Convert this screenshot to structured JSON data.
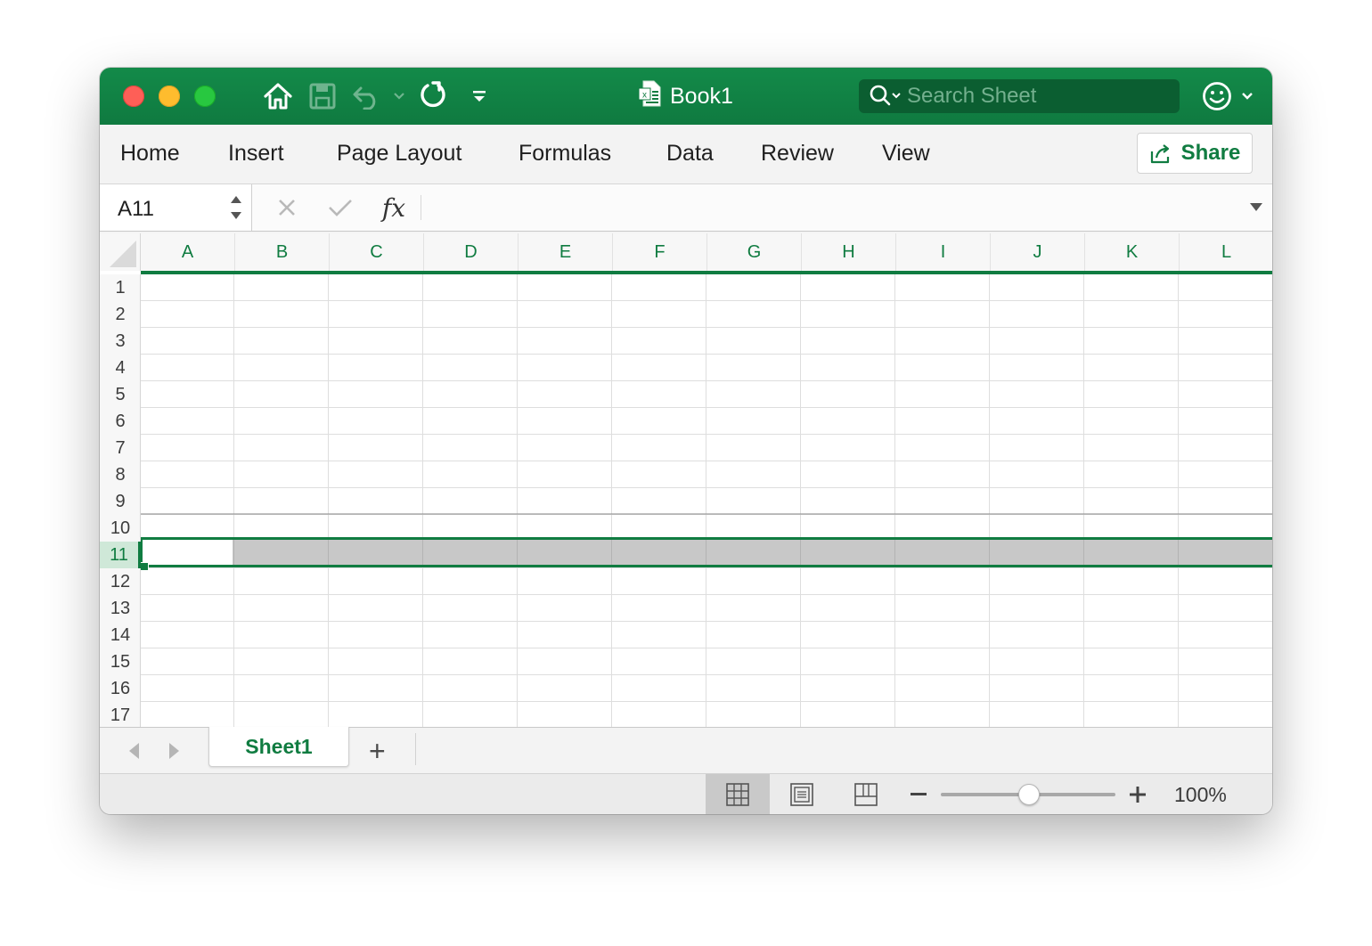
{
  "titlebar": {
    "doc_title": "Book1",
    "search_placeholder": "Search Sheet",
    "icons": [
      "home-icon",
      "save-icon",
      "undo-icon",
      "redo-icon",
      "customize-toolbar-icon",
      "excel-doc-icon",
      "search-icon",
      "smiley-feedback-icon"
    ]
  },
  "ribbon": {
    "tabs": [
      "Home",
      "Insert",
      "Page Layout",
      "Formulas",
      "Data",
      "Review",
      "View"
    ],
    "share_label": "Share"
  },
  "formula_bar": {
    "name_box": "A11",
    "fx_label": "fx",
    "formula_value": ""
  },
  "grid": {
    "columns": [
      "A",
      "B",
      "C",
      "D",
      "E",
      "F",
      "G",
      "H",
      "I",
      "J",
      "K",
      "L"
    ],
    "rows": [
      "1",
      "2",
      "3",
      "4",
      "5",
      "6",
      "7",
      "8",
      "9",
      "10",
      "11",
      "12",
      "13",
      "14",
      "15",
      "16",
      "17"
    ],
    "selected_row": "11",
    "active_cell": "A11"
  },
  "sheets": {
    "tabs": [
      "Sheet1"
    ],
    "active": "Sheet1",
    "add_label": "+"
  },
  "status": {
    "zoom": "100%",
    "zoom_fraction": 0.5
  },
  "colors": {
    "accent": "#107c41",
    "titlebar": "#107c41",
    "selection_fill": "#c8c8c8"
  }
}
